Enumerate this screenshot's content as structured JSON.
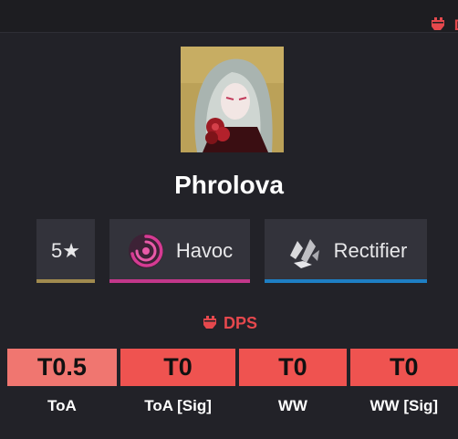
{
  "header": {
    "role_tag_text": "D",
    "role_tag_icon": "fist-icon",
    "accent_color": "#e5484d"
  },
  "character": {
    "portrait_icon": "character-portrait",
    "name": "Phrolova"
  },
  "attributes": {
    "rarity": {
      "label": "5★",
      "color": "#a08a4e"
    },
    "element": {
      "label": "Havoc",
      "icon": "havoc-swirl-icon",
      "color": "#c2378a"
    },
    "weapon": {
      "label": "Rectifier",
      "icon": "rectifier-icon",
      "color": "#1e7fc4"
    }
  },
  "role": {
    "icon": "fist-icon",
    "label": "DPS"
  },
  "tiers": [
    {
      "value": "T0.5",
      "label": "ToA",
      "color": "#f07670"
    },
    {
      "value": "T0",
      "label": "ToA [Sig]",
      "color": "#ef5350"
    },
    {
      "value": "T0",
      "label": "WW",
      "color": "#ef5350"
    },
    {
      "value": "T0",
      "label": "WW [Sig]",
      "color": "#ef5350"
    }
  ]
}
